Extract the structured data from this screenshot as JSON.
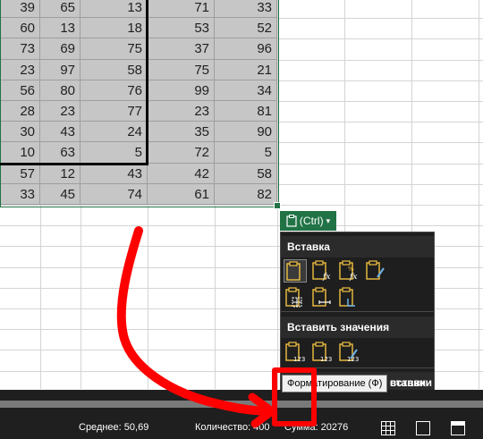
{
  "grid": {
    "rows": [
      [
        "39",
        "65",
        "13",
        "71",
        "33"
      ],
      [
        "60",
        "13",
        "18",
        "53",
        "52"
      ],
      [
        "73",
        "69",
        "75",
        "37",
        "96"
      ],
      [
        "23",
        "97",
        "58",
        "75",
        "21"
      ],
      [
        "56",
        "80",
        "76",
        "99",
        "34"
      ],
      [
        "28",
        "23",
        "77",
        "23",
        "81"
      ],
      [
        "30",
        "43",
        "24",
        "35",
        "90"
      ],
      [
        "10",
        "63",
        "5",
        "72",
        "5"
      ],
      [
        "57",
        "12",
        "43",
        "42",
        "58"
      ],
      [
        "33",
        "45",
        "74",
        "61",
        "82"
      ]
    ]
  },
  "paste_options": {
    "button_label": "(Ctrl)",
    "button_arrow": "▾",
    "sections": [
      {
        "title": "Вставка",
        "icons": [
          "paste-icon",
          "paste-formulas-icon",
          "paste-formulas-number-format-icon",
          "paste-keep-source-formatting-icon",
          "paste-no-borders-icon",
          "paste-keep-column-widths-icon",
          "paste-transpose-icon"
        ]
      },
      {
        "title": "Вставить значения",
        "icons": [
          "paste-values-icon",
          "paste-values-number-format-icon",
          "paste-values-source-formatting-icon"
        ]
      },
      {
        "title": "Другие параметры вставки",
        "icons": [
          "paste-formatting-icon",
          "paste-link-icon",
          "paste-picture-icon",
          "paste-linked-picture-icon"
        ]
      }
    ],
    "tooltip": "Форматирование (Ф)",
    "hidden_tail": "ставки"
  },
  "status": {
    "average_label": "Среднее: 50,69",
    "count_label": "Количество: 400",
    "sum_label": "Сумма: 20276"
  },
  "annotation": {
    "color": "#ff0000"
  },
  "colors": {
    "accent": "#217346",
    "menu_bg": "#1e1e1e",
    "selection": "#c6c6c6"
  }
}
